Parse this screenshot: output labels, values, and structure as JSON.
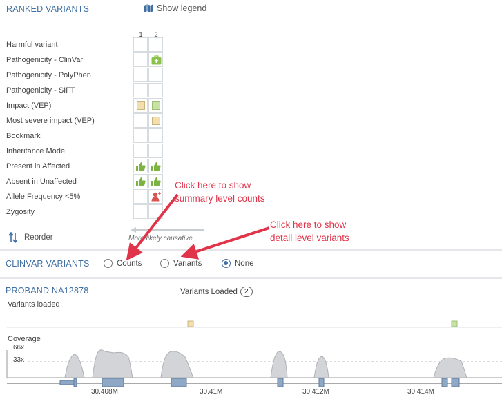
{
  "ranked": {
    "title": "RANKED VARIANTS",
    "legend_button": "Show legend",
    "columns": [
      "1",
      "2"
    ],
    "rows": [
      {
        "label": "Harmful variant",
        "cells": [
          "",
          ""
        ]
      },
      {
        "label": "Pathogenicity - ClinVar",
        "cells": [
          "",
          "clinvar"
        ]
      },
      {
        "label": "Pathogenicity - PolyPhen",
        "cells": [
          "",
          ""
        ]
      },
      {
        "label": "Pathogenicity - SIFT",
        "cells": [
          "",
          ""
        ]
      },
      {
        "label": "Impact (VEP)",
        "cells": [
          "tan",
          "green"
        ]
      },
      {
        "label": "Most severe impact (VEP)",
        "cells": [
          "",
          "tan"
        ]
      },
      {
        "label": "Bookmark",
        "cells": [
          "",
          ""
        ]
      },
      {
        "label": "Inheritance Mode",
        "cells": [
          "",
          ""
        ]
      },
      {
        "label": "Present in Affected",
        "cells": [
          "thumb",
          "thumb"
        ]
      },
      {
        "label": "Absent in Unaffected",
        "cells": [
          "thumb",
          "thumb"
        ]
      },
      {
        "label": "Allele Frequency <5%",
        "cells": [
          "",
          "person"
        ]
      },
      {
        "label": "Zygosity",
        "cells": [
          "",
          ""
        ]
      }
    ],
    "reorder": "Reorder",
    "causative": "More likely causative"
  },
  "clinvar": {
    "title": "CLINVAR VARIANTS",
    "options": [
      {
        "label": "Counts",
        "checked": false
      },
      {
        "label": "Variants",
        "checked": false
      },
      {
        "label": "None",
        "checked": true
      }
    ]
  },
  "annotations": {
    "counts_line1": "Click here to show",
    "counts_line2": "summary level counts",
    "variants_line1": "Click here to show",
    "variants_line2": "detail level variants",
    "color": "#e0344a"
  },
  "proband": {
    "title": "PROBAND NA12878",
    "variants_loaded_label": "Variants Loaded",
    "variants_loaded_count": "2",
    "variants_loaded_track": "Variants loaded",
    "coverage_label": "Coverage",
    "coverage_ticks": [
      "66x",
      "33x"
    ],
    "axis_labels": [
      "30.408M",
      "30.41M",
      "30.412M",
      "30.414M"
    ]
  },
  "colors": {
    "accent": "#3f6fa3",
    "tan": "#f3dfae",
    "green": "#c8e2a6",
    "thumb": "#7cb342",
    "coverage": "#c9ccd0",
    "gene": "#8fa8c6"
  }
}
